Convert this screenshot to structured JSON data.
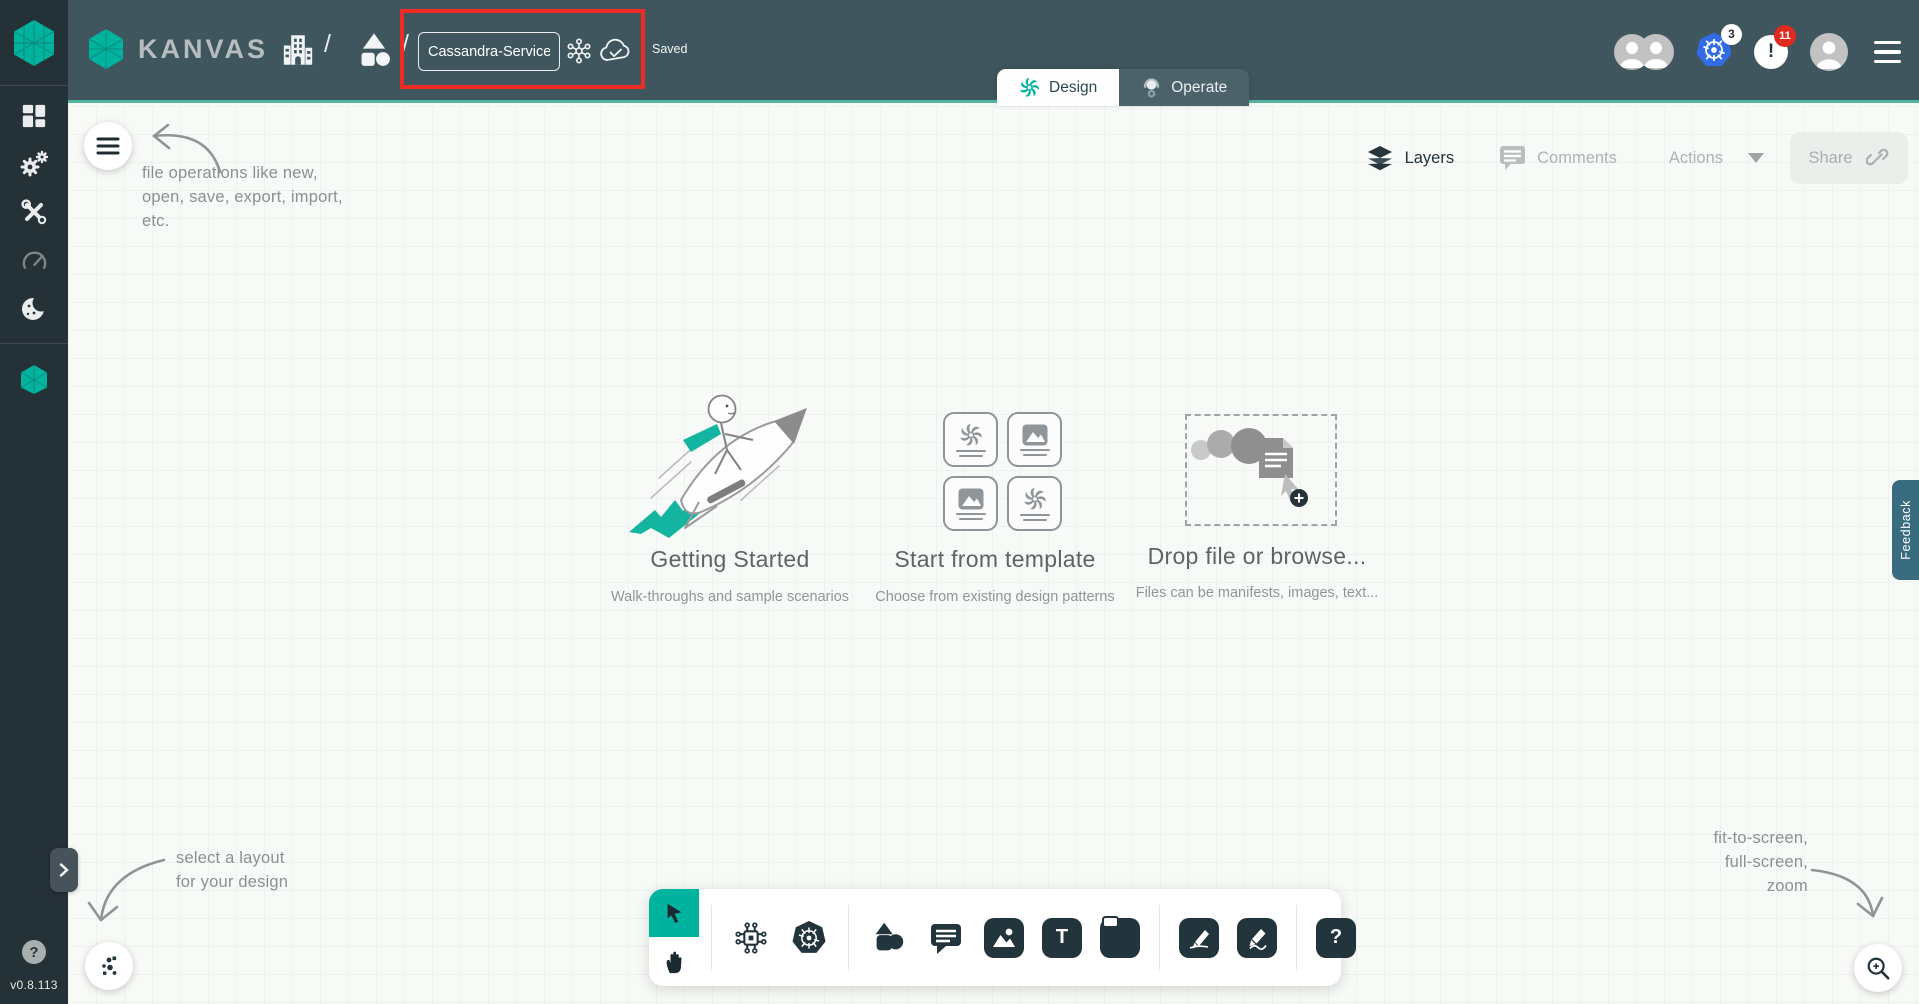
{
  "app": {
    "logo_text": "KANVAS",
    "version": "v0.8.113"
  },
  "theme": {
    "header_bg": "#3F565E",
    "sidebar_bg": "#243137",
    "accent_teal": "#00B39F",
    "canvas_bg": "#F8FAF7",
    "highlight_red": "#EE2B24",
    "feedback_bg": "#3A6C80",
    "kubernetes_blue": "#326CE5",
    "badge_red": "#E02B20",
    "tool_dark": "#22343C"
  },
  "header": {
    "breadcrumb_separator": "/",
    "design_name": "Cassandra-Service",
    "save_status": "Saved",
    "tabs": [
      {
        "label": "Design"
      },
      {
        "label": "Operate"
      }
    ],
    "kubernetes_context_badge": "3",
    "notification_glyph": "!",
    "notification_count": "11"
  },
  "canvas_controls": {
    "layers_label": "Layers",
    "comments_label": "Comments",
    "actions_label": "Actions",
    "share_label": "Share"
  },
  "annotations": {
    "file_ops_lines": [
      "file operations like new,",
      "open, save, export, import,",
      "etc."
    ],
    "layout_lines": [
      "select a layout",
      "for your design"
    ],
    "zoom_lines": [
      "fit-to-screen,",
      "full-screen,",
      "zoom"
    ]
  },
  "empty_state": {
    "cards": [
      {
        "title": "Getting Started",
        "subtitle": "Walk-throughs and sample scenarios"
      },
      {
        "title": "Start from template",
        "subtitle": "Choose from existing design patterns"
      },
      {
        "title": "Drop file or browse...",
        "subtitle": "Files can be manifests, images, text..."
      }
    ],
    "plus_glyph": "+"
  },
  "toolbar": {
    "text_tool_glyph": "T",
    "help_glyph": "?"
  },
  "sidebar": {
    "help_glyph": "?"
  },
  "feedback_label": "Feedback"
}
